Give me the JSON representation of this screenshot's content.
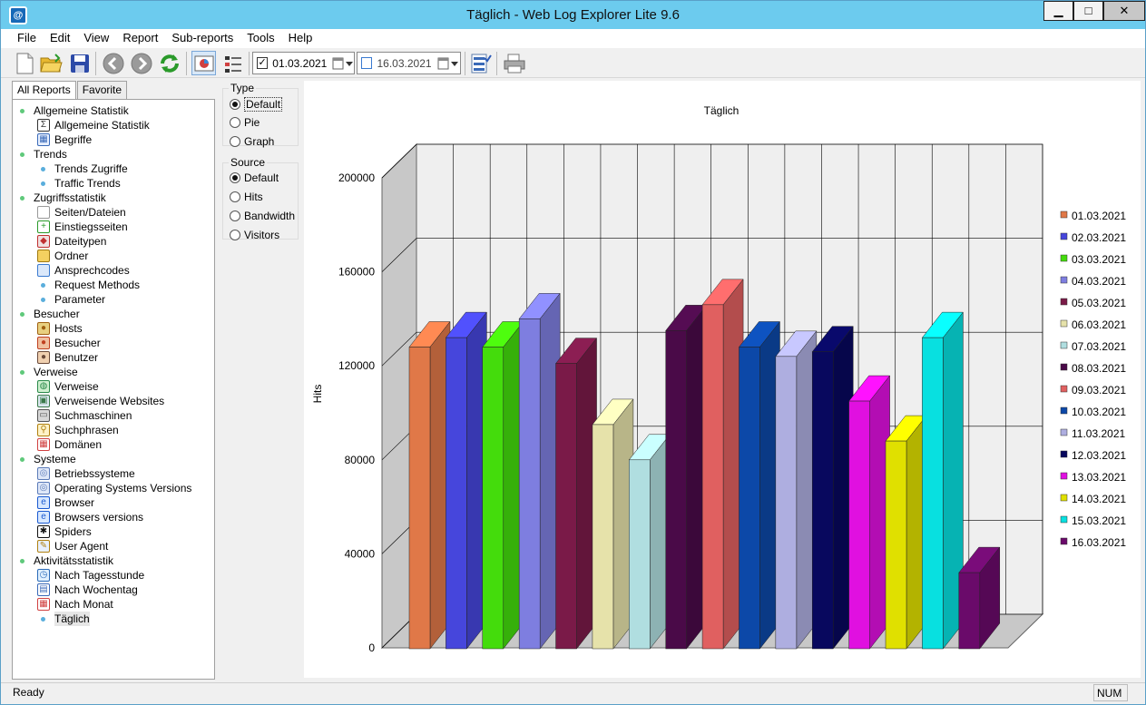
{
  "window": {
    "title": "Täglich - Web Log Explorer Lite 9.6",
    "min": "▁",
    "max": "□",
    "close": "✕"
  },
  "menu": [
    "File",
    "Edit",
    "View",
    "Report",
    "Sub-reports",
    "Tools",
    "Help"
  ],
  "toolbar": {
    "date_from": {
      "checked": true,
      "value": "01.03.2021"
    },
    "date_to": {
      "checked": false,
      "value": "16.03.2021"
    }
  },
  "left_tabs": [
    "All Reports",
    "Favorite"
  ],
  "tree": [
    {
      "label": "Allgemeine Statistik",
      "level": 0
    },
    {
      "label": "Allgemeine Statistik",
      "level": 1,
      "icon": "sigma-icon"
    },
    {
      "label": "Begriffe",
      "level": 1,
      "icon": "table-icon"
    },
    {
      "label": "Trends",
      "level": 0
    },
    {
      "label": "Trends Zugriffe",
      "level": 1,
      "icon": "dot"
    },
    {
      "label": "Traffic Trends",
      "level": 1,
      "icon": "dot"
    },
    {
      "label": "Zugriffsstatistik",
      "level": 0
    },
    {
      "label": "Seiten/Dateien",
      "level": 1,
      "icon": "page-icon"
    },
    {
      "label": "Einstiegsseiten",
      "level": 1,
      "icon": "entry-page-icon"
    },
    {
      "label": "Dateitypen",
      "level": 1,
      "icon": "filetypes-icon"
    },
    {
      "label": "Ordner",
      "level": 1,
      "icon": "folder-icon"
    },
    {
      "label": "Ansprechcodes",
      "level": 1,
      "icon": "speech-icon"
    },
    {
      "label": "Request Methods",
      "level": 1,
      "icon": "dot"
    },
    {
      "label": "Parameter",
      "level": 1,
      "icon": "dot"
    },
    {
      "label": "Besucher",
      "level": 0
    },
    {
      "label": "Hosts",
      "level": 1,
      "icon": "hosts-icon"
    },
    {
      "label": "Besucher",
      "level": 1,
      "icon": "visitor-icon"
    },
    {
      "label": "Benutzer",
      "level": 1,
      "icon": "user-icon"
    },
    {
      "label": "Verweise",
      "level": 0
    },
    {
      "label": "Verweise",
      "level": 1,
      "icon": "globe-icon"
    },
    {
      "label": "Verweisende Websites",
      "level": 1,
      "icon": "websites-icon"
    },
    {
      "label": "Suchmaschinen",
      "level": 1,
      "icon": "search-engine-icon"
    },
    {
      "label": "Suchphrasen",
      "level": 1,
      "icon": "magnifier-icon"
    },
    {
      "label": "Domänen",
      "level": 1,
      "icon": "domains-icon"
    },
    {
      "label": "Systeme",
      "level": 0
    },
    {
      "label": "Betriebssysteme",
      "level": 1,
      "icon": "disc-icon"
    },
    {
      "label": "Operating Systems Versions",
      "level": 1,
      "icon": "disc-icon"
    },
    {
      "label": "Browser",
      "level": 1,
      "icon": "ie-icon"
    },
    {
      "label": "Browsers versions",
      "level": 1,
      "icon": "ie-icon"
    },
    {
      "label": "Spiders",
      "level": 1,
      "icon": "spider-icon"
    },
    {
      "label": "User Agent",
      "level": 1,
      "icon": "user-agent-icon"
    },
    {
      "label": "Aktivitätsstatistik",
      "level": 0
    },
    {
      "label": "Nach Tagesstunde",
      "level": 1,
      "icon": "clock-icon"
    },
    {
      "label": "Nach Wochentag",
      "level": 1,
      "icon": "calendar-icon"
    },
    {
      "label": "Nach Monat",
      "level": 1,
      "icon": "month-icon"
    },
    {
      "label": "Täglich",
      "level": 1,
      "icon": "dot",
      "selected": true
    }
  ],
  "options": {
    "type_label": "Type",
    "type_options": [
      "Default",
      "Pie",
      "Graph"
    ],
    "type_selected": 0,
    "source_label": "Source",
    "source_options": [
      "Default",
      "Hits",
      "Bandwidth",
      "Visitors"
    ],
    "source_selected": 0
  },
  "chart_data": {
    "type": "bar",
    "title": "Täglich",
    "xlabel": "",
    "ylabel": "Hits",
    "ylim": [
      0,
      200000
    ],
    "yticks": [
      0,
      40000,
      80000,
      120000,
      160000,
      200000
    ],
    "grid": true,
    "legend": "right",
    "categories": [
      "01.03.2021",
      "02.03.2021",
      "03.03.2021",
      "04.03.2021",
      "05.03.2021",
      "06.03.2021",
      "07.03.2021",
      "08.03.2021",
      "09.03.2021",
      "10.03.2021",
      "11.03.2021",
      "12.03.2021",
      "13.03.2021",
      "14.03.2021",
      "15.03.2021",
      "16.03.2021"
    ],
    "values": [
      128000,
      132000,
      128000,
      140000,
      121000,
      95000,
      80000,
      135000,
      146000,
      128000,
      124000,
      126000,
      105000,
      88000,
      132000,
      32000
    ],
    "colors": [
      "#e07848",
      "#4646dc",
      "#44dc0c",
      "#7e7ee0",
      "#7a1a48",
      "#e6e2aa",
      "#b0dee0",
      "#4a0a48",
      "#e06060",
      "#0c48a8",
      "#aeaee0",
      "#08085e",
      "#e010e0",
      "#e0e000",
      "#08e0e0",
      "#6a0a6a"
    ]
  },
  "status": {
    "text": "Ready",
    "num": "NUM"
  }
}
